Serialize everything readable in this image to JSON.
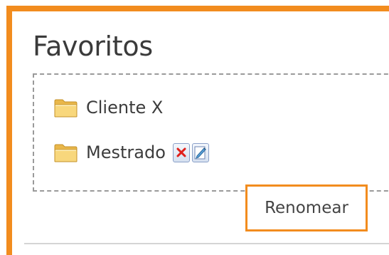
{
  "favorites": {
    "title": "Favoritos",
    "items": [
      {
        "label": "Cliente X",
        "icon": "folder-icon"
      },
      {
        "label": "Mestrado",
        "icon": "folder-icon",
        "actions": [
          "delete-icon",
          "edit-icon"
        ]
      }
    ]
  },
  "context_menu": {
    "rename_label": "Renomear"
  },
  "colors": {
    "highlight": "#f28c1e",
    "dashed_border": "#9a9a9a",
    "delete_red": "#e0201b"
  }
}
